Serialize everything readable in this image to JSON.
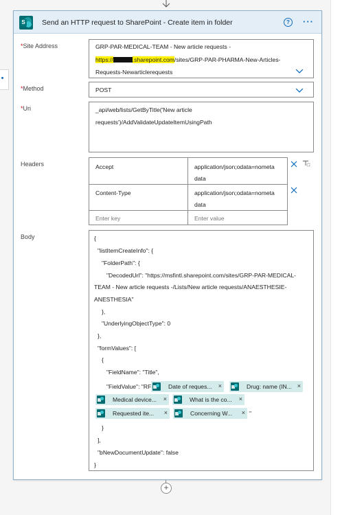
{
  "card": {
    "title": "Send an HTTP request to SharePoint - Create item in folder",
    "help_icon": "?",
    "more_icon": "···"
  },
  "site_address": {
    "required_mark": "*",
    "label": "Site Address",
    "line1": "GRP-PAR-MEDICAL-TEAM - New article requests -",
    "line2_prefix": "https://",
    "line2_highlight_suffix": ".sharepoint.com",
    "line2_rest": "/sites/GRP-PAR-PHARMA-New-Articles-",
    "line3": "Requests-Newarticlerequests"
  },
  "method": {
    "required_mark": "*",
    "label": "Method",
    "value": "POST"
  },
  "uri": {
    "required_mark": "*",
    "label": "Uri",
    "line1": "_api/web/lists/GetByTitle('New article",
    "line2": "requests')/AddValidateUpdateItemUsingPath"
  },
  "headers": {
    "label": "Headers",
    "rows": [
      {
        "key": "Accept",
        "value_line1": "application/json;odata=nometa",
        "value_line2": "data"
      },
      {
        "key": "Content-Type",
        "value_line1": "application/json;odata=nometa",
        "value_line2": "data"
      }
    ],
    "key_placeholder": "Enter key",
    "value_placeholder": "Enter value"
  },
  "body": {
    "label": "Body",
    "lines": [
      "{",
      "\"listItemCreateInfo\": {",
      "\"FolderPath\": {",
      "\"DecodedUrl\": \"https://msfintl.sharepoint.com/sites/GRP-PAR-MEDICAL-",
      "TEAM - New article requests -/Lists/New article requests/ANAESTHESIE-",
      "ANESTHESIA\"",
      "},",
      "\"UnderlyingObjectType\": 0",
      "},",
      "\"formValues\": [",
      "{",
      "\"FieldName\": \"Title\",",
      "\"FieldValue\": \"RF",
      "\"",
      "}",
      "],",
      "\"bNewDocumentUpdate\": false",
      "}"
    ],
    "tokens": [
      {
        "label": "Date of reques..."
      },
      {
        "label": "Drug: name (IN..."
      },
      {
        "label": "Medical device..."
      },
      {
        "label": "What is the co..."
      },
      {
        "label": "Requested ite..."
      },
      {
        "label": "Concerning W..."
      }
    ],
    "token_remove": "×"
  },
  "add_step": "+"
}
